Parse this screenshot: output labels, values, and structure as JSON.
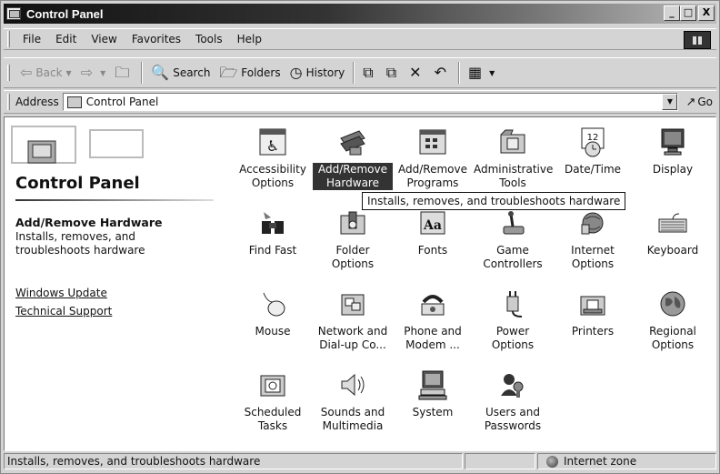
{
  "window": {
    "title": "Control Panel",
    "buttons": {
      "minimize": "_",
      "maximize": "□",
      "close": "X"
    }
  },
  "menu": {
    "items": [
      {
        "label": "File",
        "key": "F"
      },
      {
        "label": "Edit",
        "key": "E"
      },
      {
        "label": "View",
        "key": "V"
      },
      {
        "label": "Favorites",
        "key": "a"
      },
      {
        "label": "Tools",
        "key": "T"
      },
      {
        "label": "Help",
        "key": "H"
      }
    ]
  },
  "toolbar": {
    "back": "Back",
    "search": "Search",
    "folders": "Folders",
    "history": "History"
  },
  "address": {
    "label": "Address",
    "value": "Control Panel",
    "go": "Go"
  },
  "left_pane": {
    "title": "Control Panel",
    "selected_title": "Add/Remove Hardware",
    "selected_desc": "Installs, removes, and troubleshoots hardware",
    "links": [
      "Windows Update",
      "Technical Support"
    ]
  },
  "items": [
    {
      "label": "Accessibility Options",
      "icon": "accessibility-icon"
    },
    {
      "label": "Add/Remove Hardware",
      "icon": "hardware-icon",
      "selected": true
    },
    {
      "label": "Add/Remove Programs",
      "icon": "programs-icon"
    },
    {
      "label": "Administrative Tools",
      "icon": "admin-tools-icon"
    },
    {
      "label": "Date/Time",
      "icon": "calendar-clock-icon"
    },
    {
      "label": "Display",
      "icon": "monitor-icon"
    },
    {
      "label": "Find Fast",
      "icon": "binoculars-icon"
    },
    {
      "label": "Folder Options",
      "icon": "folder-options-icon"
    },
    {
      "label": "Fonts",
      "icon": "fonts-icon"
    },
    {
      "label": "Game Controllers",
      "icon": "joystick-icon"
    },
    {
      "label": "Internet Options",
      "icon": "globe-icon"
    },
    {
      "label": "Keyboard",
      "icon": "keyboard-icon"
    },
    {
      "label": "Mouse",
      "icon": "mouse-icon"
    },
    {
      "label": "Network and Dial-up Co...",
      "icon": "network-icon"
    },
    {
      "label": "Phone and Modem ...",
      "icon": "phone-icon"
    },
    {
      "label": "Power Options",
      "icon": "power-plug-icon"
    },
    {
      "label": "Printers",
      "icon": "printer-icon"
    },
    {
      "label": "Regional Options",
      "icon": "earth-icon"
    },
    {
      "label": "Scheduled Tasks",
      "icon": "scheduled-tasks-icon"
    },
    {
      "label": "Sounds and Multimedia",
      "icon": "speaker-icon"
    },
    {
      "label": "System",
      "icon": "computer-icon"
    },
    {
      "label": "Users and Passwords",
      "icon": "users-icon"
    }
  ],
  "tooltip": "Installs, removes, and troubleshoots hardware",
  "status": {
    "text": "Installs, removes, and troubleshoots hardware",
    "zone": "Internet zone"
  }
}
